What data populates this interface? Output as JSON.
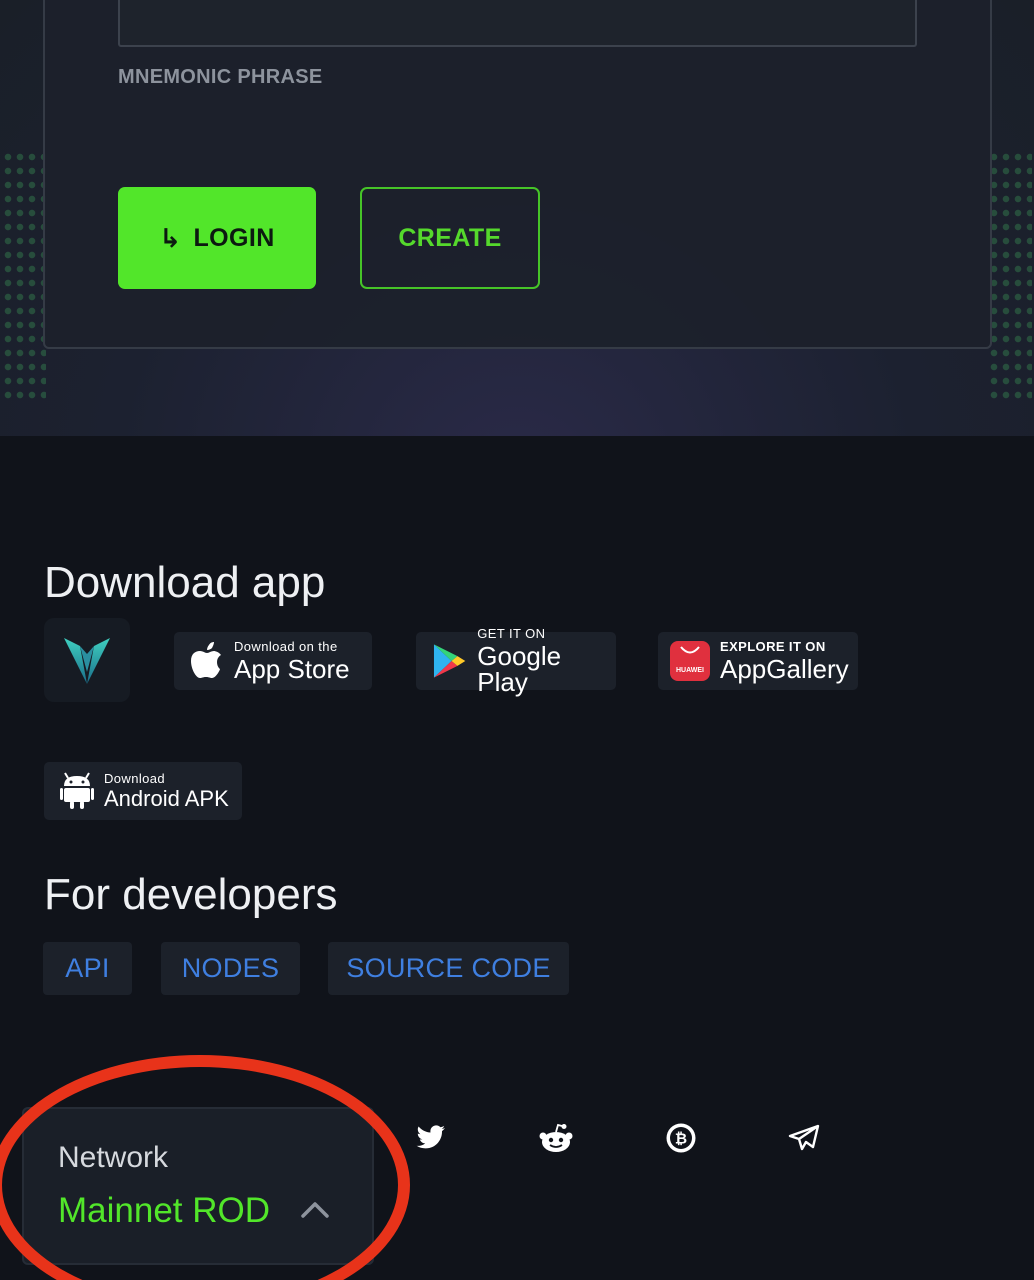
{
  "login_form": {
    "field_label": "MNEMONIC PHRASE",
    "login_arrow": "↳",
    "login_label": "LOGIN",
    "create_label": "CREATE"
  },
  "download": {
    "title": "Download app",
    "app_store": {
      "small": "Download on the",
      "big": "App Store"
    },
    "google_play": {
      "small": "GET IT ON",
      "big": "Google Play"
    },
    "app_gallery": {
      "small": "EXPLORE IT ON",
      "big": "AppGallery",
      "brand": "HUAWEI"
    },
    "android_apk": {
      "small": "Download",
      "big": "Android APK"
    }
  },
  "developers": {
    "title": "For developers",
    "links": [
      "API",
      "NODES",
      "SOURCE CODE"
    ]
  },
  "network": {
    "label": "Network",
    "value": "Mainnet ROD"
  },
  "social_icons": [
    "twitter-icon",
    "reddit-icon",
    "bitcointalk-icon",
    "telegram-icon"
  ],
  "colors": {
    "accent_green": "#52e62a",
    "link_blue": "#3f7fe0",
    "background": "#10131a",
    "annotation_red": "#e8331a"
  }
}
